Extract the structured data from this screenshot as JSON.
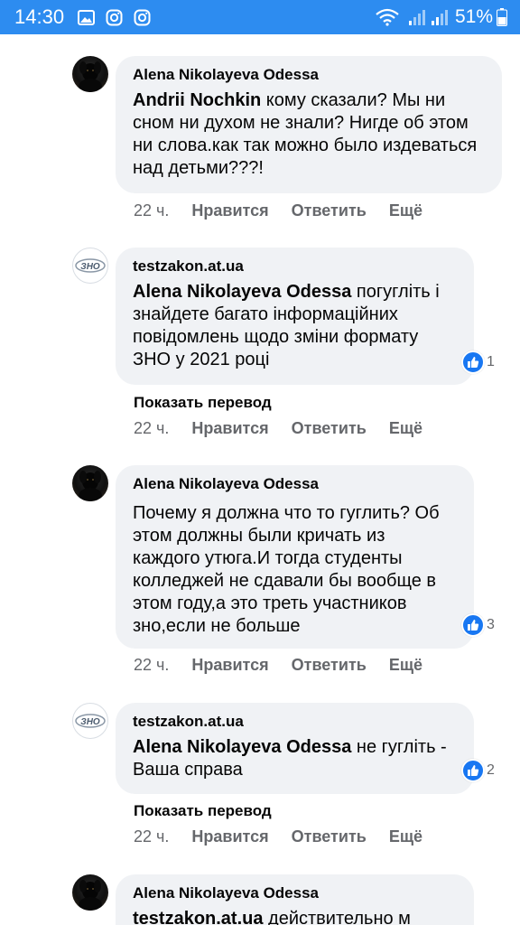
{
  "status_bar": {
    "time": "14:30",
    "battery": "51%",
    "icons": [
      "gallery-icon",
      "instagram-icon",
      "instagram-icon",
      "wifi-icon",
      "signal-icon",
      "signal-icon",
      "battery-icon"
    ]
  },
  "comments": [
    {
      "author": "Alena Nikolayeva Odessa",
      "mention": "Andrii Nochkin",
      "text": " кому сказали? Мы ни сном ни духом не знали? Нигде об этом ни слова.как так можно было издеваться над детьми???!",
      "time": "22 ч.",
      "like_label": "Нравится",
      "reply_label": "Ответить",
      "more_label": "Ещё",
      "reactions": "",
      "avatar": "dog"
    },
    {
      "author": "testzakon.at.ua",
      "mention": "Alena Nikolayeva Odessa",
      "text": " погугліть і знайдете багато інформаційних повідомлень щодо зміни формату ЗНО у 2021 році",
      "time": "22 ч.",
      "like_label": "Нравится",
      "reply_label": "Ответить",
      "more_label": "Ещё",
      "reactions": "1",
      "translate_label": "Показать перевод",
      "avatar": "zno",
      "avatar_text": "ЗНО"
    },
    {
      "author": "Alena Nikolayeva Odessa",
      "mention": "",
      "text": "Почему я должна что то гуглить? Об этом должны были кричать из каждого утюга.И тогда студенты колледжей не сдавали бы вообще в этом году,а это треть участников зно,если не больше",
      "time": "22 ч.",
      "like_label": "Нравится",
      "reply_label": "Ответить",
      "more_label": "Ещё",
      "reactions": "3",
      "avatar": "dog"
    },
    {
      "author": "testzakon.at.ua",
      "mention": "Alena Nikolayeva Odessa",
      "text": " не гугліть - Ваша справа",
      "time": "22 ч.",
      "like_label": "Нравится",
      "reply_label": "Ответить",
      "more_label": "Ещё",
      "reactions": "2",
      "translate_label": "Показать перевод",
      "avatar": "zno",
      "avatar_text": "ЗНО"
    },
    {
      "author": "Alena Nikolayeva Odessa",
      "mention": "testzakon.at.ua",
      "text": " действительно м",
      "avatar": "dog"
    }
  ]
}
